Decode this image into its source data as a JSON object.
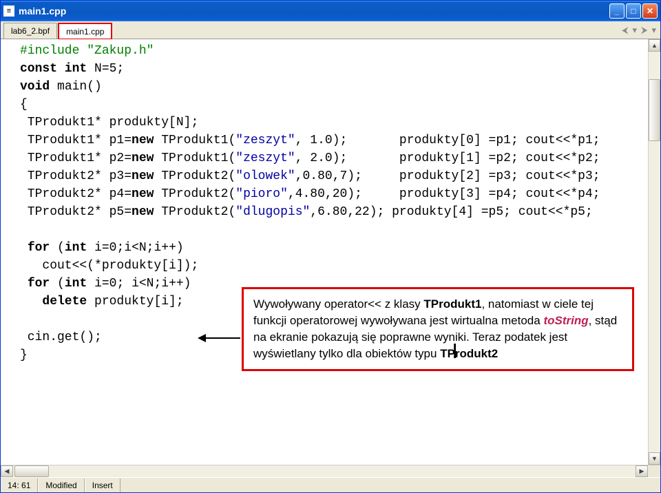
{
  "window": {
    "title": "main1.cpp"
  },
  "tabs": [
    {
      "label": "lab6_2.bpf",
      "active": false
    },
    {
      "label": "main1.cpp",
      "active": true
    }
  ],
  "code_lines": [
    {
      "segments": [
        {
          "cls": "pp",
          "t": "#include \"Zakup.h\""
        }
      ]
    },
    {
      "segments": [
        {
          "cls": "kw",
          "t": "const int "
        },
        {
          "t": "N=5;"
        }
      ]
    },
    {
      "segments": [
        {
          "cls": "kw",
          "t": "void "
        },
        {
          "t": "main()"
        }
      ]
    },
    {
      "segments": [
        {
          "t": "{"
        }
      ]
    },
    {
      "segments": [
        {
          "t": " TProdukt1* produkty[N];"
        }
      ]
    },
    {
      "segments": [
        {
          "t": " TProdukt1* p1="
        },
        {
          "cls": "kw",
          "t": "new "
        },
        {
          "t": "TProdukt1("
        },
        {
          "cls": "str",
          "t": "\"zeszyt\""
        },
        {
          "t": ", 1.0);       produkty[0] =p1; cout<<*p1;"
        }
      ]
    },
    {
      "segments": [
        {
          "t": " TProdukt1* p2="
        },
        {
          "cls": "kw",
          "t": "new "
        },
        {
          "t": "TProdukt1("
        },
        {
          "cls": "str",
          "t": "\"zeszyt\""
        },
        {
          "t": ", 2.0);       produkty[1] =p2; cout<<*p2;"
        }
      ]
    },
    {
      "segments": [
        {
          "t": " TProdukt2* p3="
        },
        {
          "cls": "kw",
          "t": "new "
        },
        {
          "t": "TProdukt2("
        },
        {
          "cls": "str",
          "t": "\"olowek\""
        },
        {
          "t": ",0.80,7);     produkty[2] =p3; cout<<*p3;"
        }
      ]
    },
    {
      "segments": [
        {
          "t": " TProdukt2* p4="
        },
        {
          "cls": "kw",
          "t": "new "
        },
        {
          "t": "TProdukt2("
        },
        {
          "cls": "str",
          "t": "\"pioro\""
        },
        {
          "t": ",4.80,20);     produkty[3] =p4; cout<<*p4;"
        }
      ]
    },
    {
      "segments": [
        {
          "t": " TProdukt2* p5="
        },
        {
          "cls": "kw",
          "t": "new "
        },
        {
          "t": "TProdukt2("
        },
        {
          "cls": "str",
          "t": "\"dlugopis\""
        },
        {
          "t": ",6.80,22); produkty[4] =p5; cout<<*p5;"
        }
      ]
    },
    {
      "segments": [
        {
          "t": ""
        }
      ]
    },
    {
      "segments": [
        {
          "t": " "
        },
        {
          "cls": "kw",
          "t": "for "
        },
        {
          "t": "("
        },
        {
          "cls": "kw",
          "t": "int "
        },
        {
          "t": "i=0;i<N;i++)"
        }
      ]
    },
    {
      "segments": [
        {
          "t": "   cout<<(*produkty[i]);"
        }
      ]
    },
    {
      "segments": [
        {
          "t": " "
        },
        {
          "cls": "kw",
          "t": "for "
        },
        {
          "t": "("
        },
        {
          "cls": "kw",
          "t": "int "
        },
        {
          "t": "i=0; i<N;i++)"
        }
      ]
    },
    {
      "segments": [
        {
          "t": "   "
        },
        {
          "cls": "kw",
          "t": "delete "
        },
        {
          "t": "produkty[i];"
        }
      ]
    },
    {
      "segments": [
        {
          "t": ""
        }
      ]
    },
    {
      "segments": [
        {
          "t": " cin.get();"
        }
      ]
    },
    {
      "segments": [
        {
          "t": "}"
        }
      ]
    }
  ],
  "callout": {
    "prefix": "Wywoływany operator<< z klasy ",
    "class1": "TProdukt1",
    "mid1": ", natomiast w ciele tej funkcji operatorowej wywoływana jest wirtualna metoda  ",
    "method": "toString",
    "mid2": ", stąd na ekranie pokazują się poprawne wyniki. Teraz podatek jest wyświetlany tylko dla obiektów typu ",
    "class2": "TProdukt2"
  },
  "status": {
    "pos": "14: 61",
    "modified": "Modified",
    "mode": "Insert"
  }
}
